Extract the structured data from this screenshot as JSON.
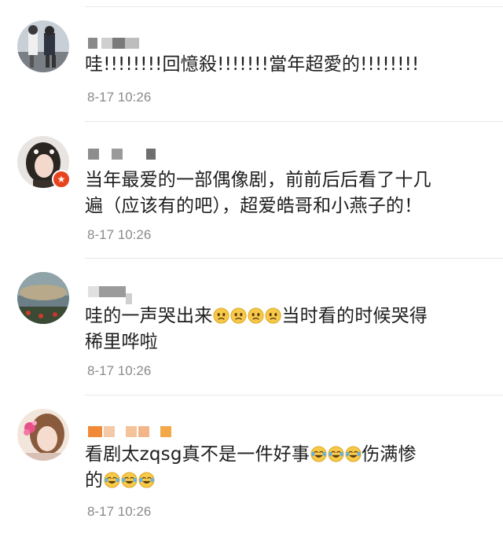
{
  "comments": [
    {
      "text_before": "哇!!!!!!!!回憶殺!!!!!!!當年超愛的!!!!!!!!",
      "time": "8-17 10:26",
      "avatar_icon": "user-photo-avatar"
    },
    {
      "line1": "当年最爱的一部偶像剧，前前后后看了十几",
      "line2": "遍（应该有的吧），超爱皓哥和小燕子的！",
      "time": "8-17 10:26",
      "avatar_icon": "user-photo-avatar",
      "badge_icon": "verified-star-icon"
    },
    {
      "text_a": "哇的一声哭出来",
      "text_b": "当时看的时候哭得",
      "line2": "稀里哗啦",
      "emoji_icon": "sad-face-icon",
      "emoji_count": 4,
      "time": "8-17 10:26",
      "avatar_icon": "user-photo-avatar"
    },
    {
      "text_a": "看剧太zqsg真不是一件好事",
      "text_b": "伤满惨",
      "line2": "的",
      "emoji_icon": "crying-laughing-face-icon",
      "emoji_count": 3,
      "time": "8-17 10:26",
      "avatar_icon": "user-photo-avatar"
    }
  ],
  "colors": {
    "text": "#1e1e1e",
    "time": "#8a8a8a",
    "separator": "#e6e6e6",
    "badge": "#e8431f"
  }
}
